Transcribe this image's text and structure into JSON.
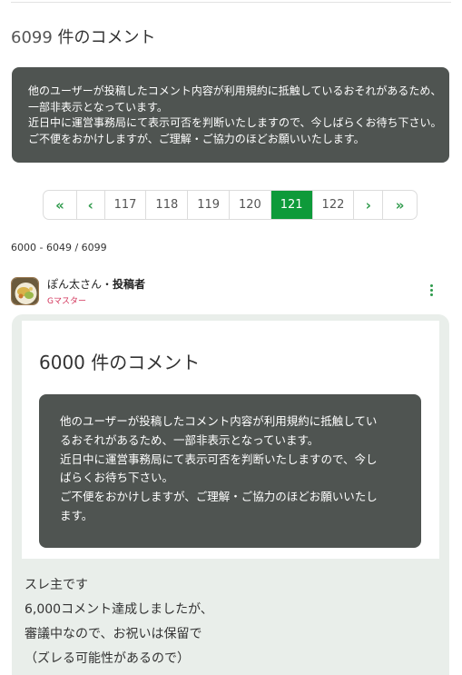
{
  "header": {
    "count": "6099",
    "count_suffix": "件のコメント"
  },
  "notice": {
    "lines": [
      "他のユーザーが投稿したコメント内容が利用規約に抵触しているおそれがあるため、",
      "一部非表示となっています。",
      "近日中に運営事務局にて表示可否を判断いたしますので、今しばらくお待ち下さい。",
      "ご不便をおかけしますが、ご理解・ご協力のほどお願いいたします。"
    ]
  },
  "pagination": {
    "first_icon": "double-chevron-left-icon",
    "prev_icon": "chevron-left-icon",
    "next_icon": "chevron-right-icon",
    "last_icon": "double-chevron-right-icon",
    "pages": [
      "117",
      "118",
      "119",
      "120",
      "121",
      "122"
    ],
    "current": "121",
    "accent_color": "#0e9a3a"
  },
  "range_text": "6000 - 6049 / 6099",
  "post": {
    "author": "ぽん太さん",
    "separator": "・",
    "role": "投稿者",
    "rank": "Gマスター",
    "menu_icon": "kebab-menu-icon",
    "quoted_image": {
      "count_text": "6000 件のコメント",
      "notice_lines": [
        "他のユーザーが投稿したコメント内容が利用規約に抵触してい",
        "るおそれがあるため、一部非表示となっています。",
        "近日中に運営事務局にて表示可否を判断いたしますので、今し",
        "ばらくお待ち下さい。",
        "ご不便をおかけしますが、ご理解・ご協力のほどお願いいたし",
        "ます。"
      ]
    },
    "body_lines": [
      "スレ主です",
      "6,000コメント達成しましたが、",
      "審議中なので、お祝いは保留で",
      "（ズレる可能性があるので）"
    ]
  }
}
